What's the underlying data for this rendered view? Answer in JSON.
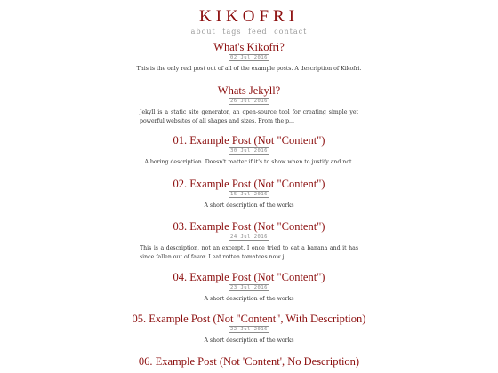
{
  "site": {
    "title": "KIKOFRI",
    "nav": [
      "about",
      "tags",
      "feed",
      "contact"
    ]
  },
  "posts": [
    {
      "title": "What's Kikofri?",
      "date": "02 Jul 2016",
      "description": "This is the only real post out of all of the example posts. A description of Kikofri."
    },
    {
      "title": "Whats Jekyll?",
      "date": "26 Jul 2016",
      "description": "Jekyll is a static site generator, an open-source tool for creating simple yet powerful websites of all shapes and sizes. From the p..."
    },
    {
      "title": "01. Example Post (Not \"Content\")",
      "date": "30 Jul 2016",
      "description": "A boring description. Doesn't matter if it's to show when to justify and not."
    },
    {
      "title": "02. Example Post (Not \"Content\")",
      "date": "15 Jul 2016",
      "description": "A short description of the works"
    },
    {
      "title": "03. Example Post (Not \"Content\")",
      "date": "24 Jul 2016",
      "description": "This is a description, not an excerpt. I once tried to eat a banana and it has since fallen out of favor. I eat rotten tomatoes now j..."
    },
    {
      "title": "04. Example Post (Not \"Content\")",
      "date": "23 Jul 2016",
      "description": "A short description of the works"
    },
    {
      "title": "05. Example Post (Not \"Content\", With Description)",
      "date": "22 Jul 2016",
      "description": "A short description of the works"
    },
    {
      "title": "06. Example Post (Not 'Content', No Description)",
      "date": "",
      "description": ""
    }
  ],
  "colors": {
    "accent": "#8b0d0d",
    "muted": "#9a9a9a",
    "text": "#333333"
  }
}
